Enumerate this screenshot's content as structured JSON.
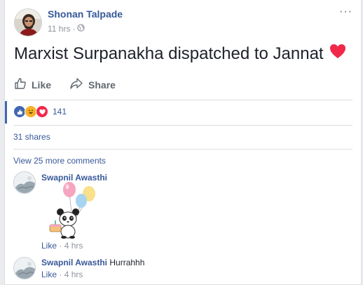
{
  "post": {
    "author": "Shonan Talpade",
    "time": "11 hrs",
    "sep": "·",
    "text": "Marxist Surpanakha dispatched to Jannat",
    "more": "···"
  },
  "actions": {
    "like": "Like",
    "share": "Share"
  },
  "stats": {
    "reaction_count": "141",
    "shares": "31 shares"
  },
  "comments": {
    "view_more": "View 25 more comments",
    "items": [
      {
        "name": "Swapnil Awasthi",
        "text": "",
        "like": "Like",
        "sep": "·",
        "time": "4 hrs"
      },
      {
        "name": "Swapnil Awasthi",
        "text": "Hurrahhh",
        "like": "Like",
        "sep": "·",
        "time": "4 hrs"
      }
    ]
  },
  "icons": {
    "globe": "globe-icon",
    "more": "more-options-icon",
    "like": "thumbs-up-icon",
    "share": "share-arrow-icon",
    "heart": "heart-icon",
    "sticker": "panda-balloons-sticker"
  },
  "colors": {
    "link": "#365899",
    "like_blue": "#4267b2",
    "heart": "#f0284a",
    "haha": "#f7b125"
  }
}
